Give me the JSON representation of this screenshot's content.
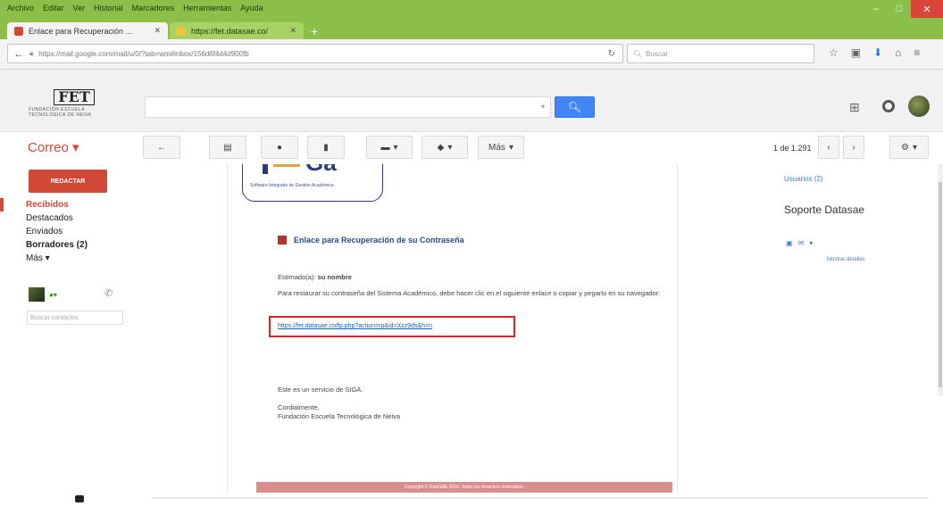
{
  "browser": {
    "menu": [
      "Archivo",
      "Editar",
      "Ver",
      "Historial",
      "Marcadores",
      "Herramientas",
      "Ayuda"
    ],
    "tabs": [
      {
        "label": "Enlace para Recuperación ...",
        "active": true
      },
      {
        "label": "https://fet.datasae.co/",
        "active": false
      }
    ],
    "new_tab": "+",
    "url": "https://mail.google.com/mail/u/0/?tab=wm#inbox/156d6f4d4d900fb",
    "search_placeholder": "Buscar",
    "colors": {
      "frame": "#8cbf4a",
      "accent": "#4285f4",
      "brand_red": "#d14836"
    }
  },
  "gmail": {
    "logo_text": "FET",
    "logo_sub": "FUNDACIÓN ESCUELA TECNOLÓGICA DE NEIVA",
    "label": "Correo",
    "more": "Más",
    "pager": "1 de 1.291",
    "compose": "REDACTAR",
    "folders": [
      "Recibidos",
      "Destacados",
      "Enviados",
      "Borradores (2)",
      "Más"
    ],
    "chat_search": "Buscar contactos"
  },
  "email": {
    "logo_subtitle": "Software Integrado de Gestión Académica",
    "heading": "Enlace para Recuperación de su Contraseña",
    "greeting_label": "Estimado(a):",
    "greeting_name": "su nombre",
    "body": "Para restaurar su contraseña del Sistema Académico, debe hacer clic en el siguiente enlace o copiar y pegarlo en su navegador:",
    "link": "https://fet.datasae.co/fp.php?action=rp&id=Xzz9ds&h=n",
    "service_note": "Este es un servicio de SIGA.",
    "closing": "Cordialmente,",
    "signature": "Fundación Escuela Tecnológica de Neiva",
    "footer": "Copyright © DataSAE 2016. Todos los derechos reservados."
  },
  "right_panel": {
    "users": "Usuarios (2)",
    "contact": "Soporte Datasae",
    "more_details": "Mostrar detalles"
  }
}
